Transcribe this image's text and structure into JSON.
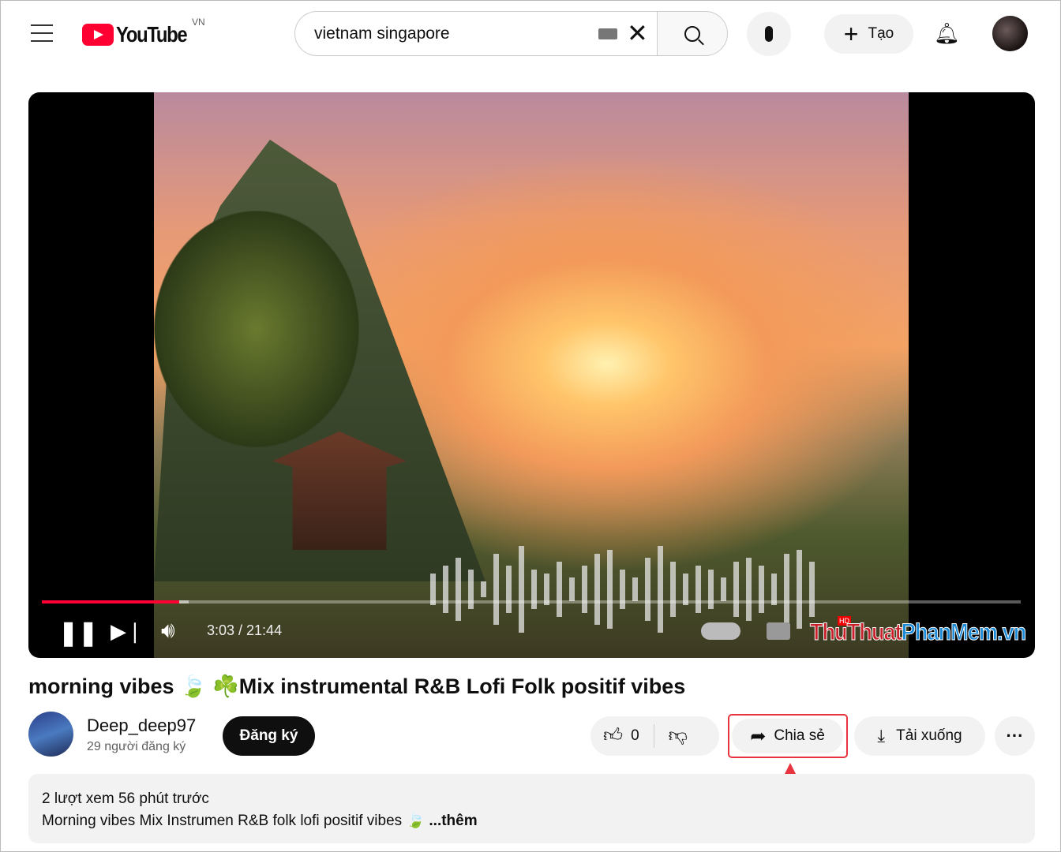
{
  "header": {
    "logo_text": "YouTube",
    "region": "VN",
    "search_value": "vietnam singapore",
    "create_label": "Tạo",
    "icons": [
      "menu-icon",
      "keyboard-icon",
      "clear-icon",
      "search-icon",
      "microphone-icon",
      "plus-icon",
      "bell-icon"
    ]
  },
  "player": {
    "current_time": "3:03",
    "duration": "21:44",
    "time_display": "3:03 / 21:44",
    "progress_percent": 14,
    "quality_badge": "HD",
    "autoplay": true
  },
  "watermark": {
    "part1": "ThuThuat",
    "part2": "PhanMem.vn"
  },
  "video": {
    "title": "morning vibes 🍃 ☘️Mix instrumental R&B Lofi Folk positif vibes"
  },
  "channel": {
    "name": "Deep_deep97",
    "subscribers": "29 người đăng ký",
    "subscribe_label": "Đăng ký"
  },
  "actions": {
    "likes": "0",
    "share_label": "Chia sẻ",
    "download_label": "Tải xuống",
    "more_label": "···"
  },
  "description": {
    "meta": "2 lượt xem  56 phút trước",
    "text": "Morning vibes Mix Instrumen R&B folk lofi positif vibes 🍃 ",
    "more": "...thêm"
  },
  "colors": {
    "accent": "#ff0033",
    "highlight": "#e8343f"
  }
}
